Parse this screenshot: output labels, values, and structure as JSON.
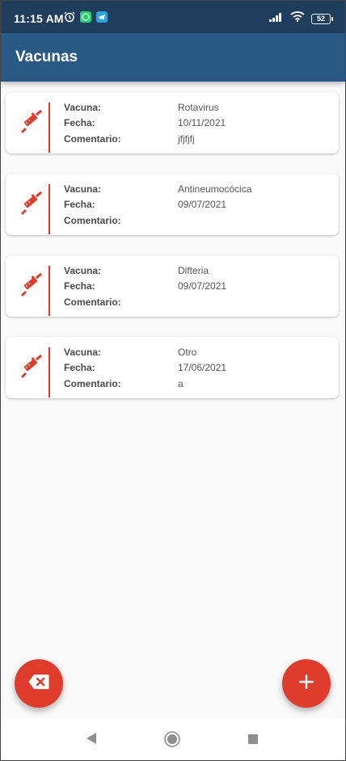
{
  "status_bar": {
    "time": "11:15 AM",
    "battery": "52",
    "icons": [
      "alarm-icon",
      "whatsapp-icon",
      "telegram-icon",
      "signal-icon",
      "wifi-icon",
      "battery-icon"
    ]
  },
  "app_bar": {
    "title": "Vacunas"
  },
  "labels": {
    "vacuna": "Vacuna:",
    "fecha": "Fecha:",
    "comentario": "Comentario:"
  },
  "vaccines": [
    {
      "vacuna": "Rotavirus",
      "fecha": "10/11/2021",
      "comentario": "jfjfjfj"
    },
    {
      "vacuna": "Antineumocócica",
      "fecha": "09/07/2021",
      "comentario": ""
    },
    {
      "vacuna": "Difteria",
      "fecha": "09/07/2021",
      "comentario": ""
    },
    {
      "vacuna": "Otro",
      "fecha": "17/06/2021",
      "comentario": "a"
    }
  ],
  "fabs": {
    "delete_icon": "backspace-x-icon",
    "add_icon": "plus-icon"
  },
  "colors": {
    "status_bar": "#1f3d5c",
    "app_bar": "#2b5985",
    "accent": "#e03c2d"
  }
}
